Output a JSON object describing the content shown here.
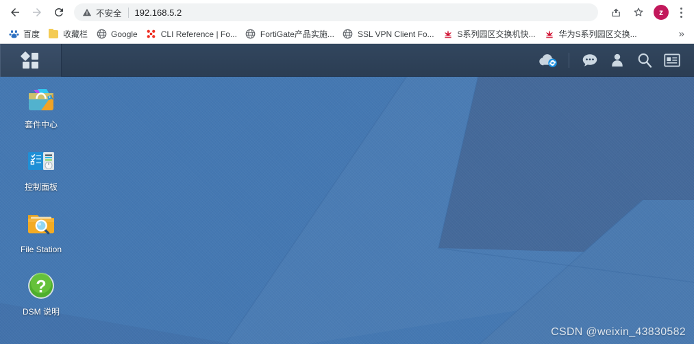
{
  "browser": {
    "back_label": "Back",
    "forward_label": "Forward",
    "reload_label": "Reload",
    "security_label": "不安全",
    "url": "192.168.5.2",
    "share_label": "Share",
    "bookmark_label": "Bookmark this tab",
    "profile_initial": "z",
    "menu_label": "Customize and control Google Chrome",
    "icons": {
      "back": "arrow-left-icon",
      "forward": "arrow-right-icon",
      "reload": "reload-icon",
      "warning": "warning-triangle-icon",
      "share": "share-icon",
      "star": "star-icon",
      "avatar": "profile-avatar",
      "kebab": "three-dot-menu-icon"
    }
  },
  "bookmarks": {
    "overflow_label": "»",
    "items": [
      {
        "label": "百度",
        "icon": "baidu-paw-icon"
      },
      {
        "label": "收藏栏",
        "icon": "folder-icon"
      },
      {
        "label": "Google",
        "icon": "globe-icon"
      },
      {
        "label": "CLI Reference | Fo...",
        "icon": "fortinet-icon"
      },
      {
        "label": "FortiGate产品实施...",
        "icon": "globe-icon"
      },
      {
        "label": "SSL VPN Client Fo...",
        "icon": "globe-icon"
      },
      {
        "label": "S系列园区交换机快...",
        "icon": "huawei-icon"
      },
      {
        "label": "华为S系列园区交换...",
        "icon": "huawei-icon"
      }
    ]
  },
  "dsm": {
    "header": {
      "main_menu_label": "主菜单",
      "main_menu_icon": "grid-menu-icon",
      "actions": [
        {
          "name": "cloud-sync-icon",
          "label": "Cloud Station"
        },
        {
          "name": "notification-icon",
          "label": "通知"
        },
        {
          "name": "user-icon",
          "label": "个人设置"
        },
        {
          "name": "search-icon",
          "label": "搜索"
        },
        {
          "name": "widget-icon",
          "label": "小工具"
        }
      ]
    },
    "desktop_icons": [
      {
        "label": "套件中心",
        "icon": "package-center-icon"
      },
      {
        "label": "控制面板",
        "icon": "control-panel-icon"
      },
      {
        "label": "File Station",
        "icon": "file-station-icon"
      },
      {
        "label": "DSM 说明",
        "icon": "dsm-help-icon"
      }
    ],
    "watermark": "CSDN @weixin_43830582"
  },
  "colors": {
    "desktop_base": "#4478b2",
    "header_bar": "#2c4158",
    "avatar_pink": "#c2185b",
    "fortinet_red": "#ee3124",
    "huawei_red": "#cf0a2c",
    "help_green": "#4caf2f",
    "folder_yellow": "#f0a830"
  }
}
